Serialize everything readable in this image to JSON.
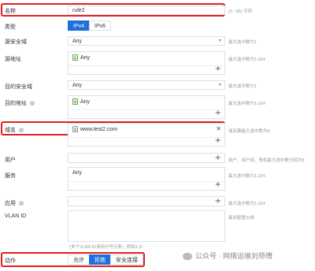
{
  "name": {
    "label": "名称",
    "value": "rule2",
    "hint": "(0 - 95) 字符"
  },
  "type": {
    "label": "类型",
    "options": [
      "IPv4",
      "IPv6"
    ],
    "selected": "IPv4"
  },
  "src_zone": {
    "label": "源安全域",
    "value": "Any",
    "hint": "最大选中数为1"
  },
  "src_addr": {
    "label": "源地址",
    "entry": "Any",
    "hint": "最大选中数为1,024"
  },
  "dst_zone": {
    "label": "目的安全域",
    "value": "Any",
    "hint": "最大选中数为1"
  },
  "dst_addr": {
    "label": "目的地址",
    "entry": "Any",
    "hint": "最大选中数为1,024"
  },
  "domain": {
    "label": "域名",
    "entry": "www.test2.com",
    "hint": "域名簇最大选中数为8"
  },
  "user": {
    "label": "用户",
    "hint": "用户、用户组、角色最大选中数分别为8"
  },
  "service": {
    "label": "服务",
    "entry": "Any",
    "hint": "最大选中数为1,024"
  },
  "app": {
    "label": "应用",
    "hint": "最大选中数为1,024"
  },
  "vlan": {
    "label": "VLAN ID",
    "hint": "最多配置32条",
    "footnote": "(多个VLAN ID请用分号分割，例如1;2)"
  },
  "action": {
    "label": "动作",
    "options": [
      "允许",
      "拒绝",
      "安全连接"
    ],
    "selected": "拒绝"
  },
  "watermark": "公众号 · 网络运维刘师傅",
  "colors": {
    "accent": "#1e6fd9",
    "highlight": "#e02020"
  }
}
